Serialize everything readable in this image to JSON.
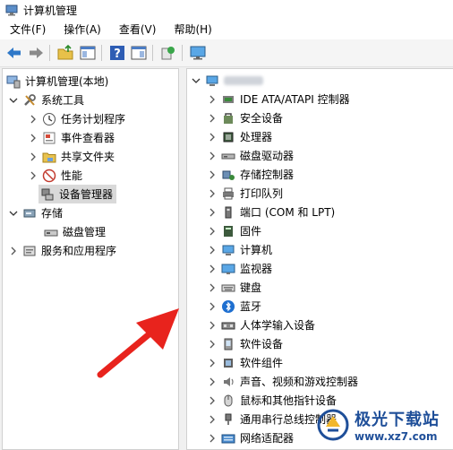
{
  "window": {
    "title": "计算机管理"
  },
  "menu": [
    {
      "label": "文件(F)"
    },
    {
      "label": "操作(A)"
    },
    {
      "label": "查看(V)"
    },
    {
      "label": "帮助(H)"
    }
  ],
  "toolbar": {
    "icons": [
      "back-arrow-icon",
      "forward-arrow-icon",
      "up-folder-icon",
      "show-tree-icon",
      "help-icon",
      "properties-icon",
      "export-icon",
      "monitor-icon"
    ]
  },
  "tree": {
    "root": "计算机管理(本地)",
    "system_tools": "系统工具",
    "task_scheduler": "任务计划程序",
    "event_viewer": "事件查看器",
    "shared_folders": "共享文件夹",
    "performance": "性能",
    "device_manager": "设备管理器",
    "storage": "存储",
    "disk_management": "磁盘管理",
    "services_apps": "服务和应用程序"
  },
  "devices": {
    "computer_name_hidden": "",
    "items": [
      {
        "label": "IDE ATA/ATAPI 控制器",
        "icon": "ide-controller-icon"
      },
      {
        "label": "安全设备",
        "icon": "security-device-icon"
      },
      {
        "label": "处理器",
        "icon": "processor-icon"
      },
      {
        "label": "磁盘驱动器",
        "icon": "disk-drive-icon"
      },
      {
        "label": "存储控制器",
        "icon": "storage-controller-icon"
      },
      {
        "label": "打印队列",
        "icon": "printer-icon"
      },
      {
        "label": "端口 (COM 和 LPT)",
        "icon": "port-icon"
      },
      {
        "label": "固件",
        "icon": "firmware-icon"
      },
      {
        "label": "计算机",
        "icon": "computer-icon"
      },
      {
        "label": "监视器",
        "icon": "monitor-icon"
      },
      {
        "label": "键盘",
        "icon": "keyboard-icon"
      },
      {
        "label": "蓝牙",
        "icon": "bluetooth-icon"
      },
      {
        "label": "人体学输入设备",
        "icon": "hid-icon"
      },
      {
        "label": "软件设备",
        "icon": "software-device-icon"
      },
      {
        "label": "软件组件",
        "icon": "software-component-icon"
      },
      {
        "label": "声音、视频和游戏控制器",
        "icon": "sound-icon"
      },
      {
        "label": "鼠标和其他指针设备",
        "icon": "mouse-icon"
      },
      {
        "label": "通用串行总线控制器",
        "icon": "usb-icon"
      },
      {
        "label": "网络适配器",
        "icon": "network-adapter-icon"
      }
    ]
  },
  "watermark": {
    "main": "极光下载站",
    "sub": "www.xz7.com"
  },
  "colors": {
    "accent_arrow": "#e8231d",
    "watermark": "#1f4f99",
    "selected": "#d9d9d9"
  }
}
